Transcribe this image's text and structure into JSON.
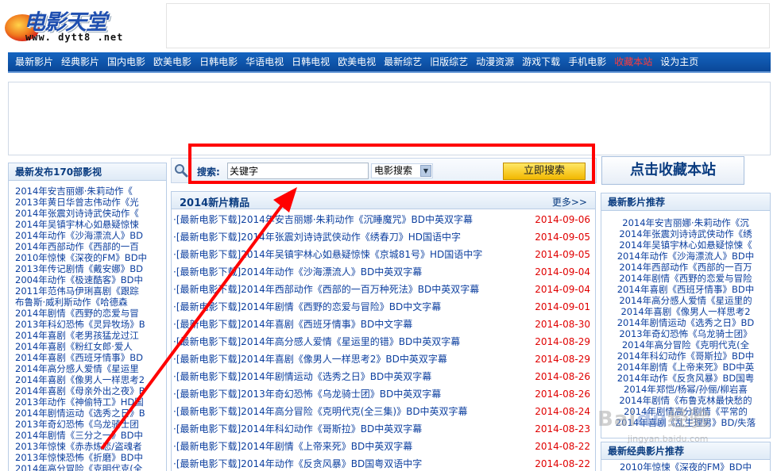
{
  "logo": {
    "title": "电影天堂",
    "url": "www. dytt8 .net"
  },
  "nav": {
    "items": [
      "最新影片",
      "经典影片",
      "国内电影",
      "欧美电影",
      "日韩电影",
      "华语电视",
      "日韩电视",
      "欧美电视",
      "最新综艺",
      "旧版综艺",
      "动漫资源",
      "游戏下载",
      "手机电影",
      "收藏本站",
      "设为主页"
    ],
    "hot_index": 13,
    "hot_color": "#ff3b3b"
  },
  "left": {
    "title": "最新发布170部影视",
    "items": [
      "2014年安吉丽娜·朱莉动作《",
      "2013年黄日华曾志伟动作《光",
      "2014年张震刘诗诗武侠动作《",
      "2014年吴镇宇林心如悬疑惊悚",
      "2014年动作《沙海漂流人》BD",
      "2014年西部动作《西部的一百",
      "2010年惊悚《深夜的FM》BD中",
      "2013年传记剧情《戴安娜》BD",
      "2004年动作《极速酷客》BD中",
      "2011年范伟马伊琍喜剧《跟踪",
      "布鲁斯·威利斯动作《哈德森",
      "2014年剧情《西野的恋爱与冒",
      "2013年科幻恐怖《灵异牧场》B",
      "2014年喜剧《老男孩猛龙过江",
      "2014年喜剧《粉红女郎·爱人",
      "2014年喜剧《西班牙情事》BD",
      "2014年高分感人爱情《星运里",
      "2014年喜剧《像男人一样思考2",
      "2014年喜剧《母亲外出之夜》B",
      "2013年动作《神偷特工》HD国",
      "2014年剧情运动《选秀之日》B",
      "2013年奇幻恐怖《乌龙骑士团",
      "2014年剧情《三分之一》BD中",
      "2013年惊悚《赤赤炼恋/盗魂者",
      "2013年惊悚恐怖《折磨》BD中",
      "2014年高分冒险《克明代克(全"
    ]
  },
  "search": {
    "label": "搜索:",
    "value": "关键字",
    "select": "电影搜索",
    "button": "立即搜索"
  },
  "fav_button": "点击收藏本站",
  "middle": {
    "title": "2014新片精品",
    "more": "更多>>",
    "rows": [
      {
        "text": "·[最新电影下载]2014年安吉丽娜·朱莉动作《沉睡魔咒》BD中英双字幕",
        "date": "2014-09-06"
      },
      {
        "text": "·[最新电影下载]2014年张震刘诗诗武侠动作《绣春刀》HD国语中字",
        "date": "2014-09-05"
      },
      {
        "text": "·[最新电影下载]2014年吴镇宇林心如悬疑惊悚《京城81号》HD国语中字",
        "date": "2014-09-05"
      },
      {
        "text": "·[最新电影下载]2014年动作《沙海漂流人》BD中英双字幕",
        "date": "2014-09-04"
      },
      {
        "text": "·[最新电影下载]2014年西部动作《西部的一百万种死法》BD中英双字幕",
        "date": "2014-09-04"
      },
      {
        "text": "·[最新电影下载]2014年剧情《西野的恋爱与冒险》BD中文字幕",
        "date": "2014-09-01"
      },
      {
        "text": "·[最新电影下载]2014年喜剧《西班牙情事》BD中文字幕",
        "date": "2014-08-30"
      },
      {
        "text": "·[最新电影下载]2014年高分感人爱情《星运里的错》BD中英双字幕",
        "date": "2014-08-29"
      },
      {
        "text": "·[最新电影下载]2014年喜剧《像男人一样思考2》BD中英双字幕",
        "date": "2014-08-29"
      },
      {
        "text": "·[最新电影下载]2014年剧情运动《选秀之日》BD中英双字幕",
        "date": "2014-08-26"
      },
      {
        "text": "·[最新电影下载]2013年奇幻恐怖《乌龙骑士团》BD中英双字幕",
        "date": "2014-08-26"
      },
      {
        "text": "·[最新电影下载]2014年高分冒险《克明代克(全三集)》BD中英双字幕",
        "date": "2014-08-24"
      },
      {
        "text": "·[最新电影下载]2014年科幻动作《哥斯拉》BD中英双字幕",
        "date": "2014-08-23"
      },
      {
        "text": "·[最新电影下载]2014年剧情《上帝来死》BD中英双字幕",
        "date": "2014-08-22"
      },
      {
        "text": "·[最新电影下载]2014年动作《反贪风暴》BD国粤双语中字",
        "date": "2014-08-22"
      }
    ]
  },
  "right": {
    "title": "最新影片推荐",
    "items": [
      "2014年安吉丽娜·朱莉动作《沉",
      "2014年张震刘诗诗武侠动作《绣",
      "2014年吴镇宇林心如悬疑惊悚《",
      "2014年动作《沙海漂流人》BD中",
      "2014年西部动作《西部的一百万",
      "2014年剧情《西野的恋爱与冒险",
      "2014年喜剧《西班牙情事》BD中",
      "2014年高分感人爱情《星运里的",
      "2014年喜剧《像男人一样思考2",
      "2014年剧情运动《选秀之日》BD",
      "2013年奇幻恐怖《乌龙骑士团》",
      "2014年高分冒险《克明代克(全",
      "2014年科幻动作《哥斯拉》BD中",
      "2014年剧情《上帝来死》BD中英",
      "2014年动作《反贪风暴》BD国粤",
      "2014年郑恺/杨幂/孙俪/柳岩喜",
      "2014年剧情《布鲁克林最快愁的",
      "2014年剧情高分剧情《平常的",
      "2014年喜剧《乱生理男》BD/失落"
    ],
    "title2": "最新经典影片推荐",
    "item2": "2010年惊悚《深夜的FM》BD中"
  },
  "annotation_color": "#ff0000"
}
